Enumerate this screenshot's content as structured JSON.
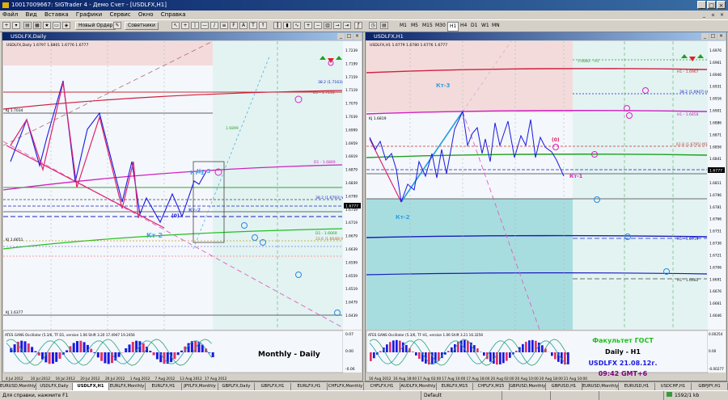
{
  "window": {
    "title": "10017009667: SIGTrader 4 - Демо Счет - [USDLFX,H1]"
  },
  "menu": [
    "Файл",
    "Вид",
    "Вставка",
    "Графики",
    "Сервис",
    "Окно",
    "Справка"
  ],
  "toolbar": {
    "new_order": "Новый Ордер",
    "advisors": "Советники",
    "timeframes": [
      "M1",
      "M5",
      "M15",
      "M30",
      "H1",
      "H4",
      "D1",
      "W1",
      "MN"
    ]
  },
  "left_chart": {
    "window_title": "USDLFX,Daily",
    "info": "USDLFX,Daily  1.6797 1.6801 1.6776 1.6777",
    "price_axis": [
      "1.7239",
      "1.7199",
      "1.7159",
      "1.7119",
      "1.7079",
      "1.7039",
      "1.6999",
      "1.6959",
      "1.6919",
      "1.6879",
      "1.6839",
      "1.6799",
      "1.6759",
      "1.6719",
      "1.6679",
      "1.6639",
      "1.6599",
      "1.6559",
      "1.6519",
      "1.6479",
      "1.6439"
    ],
    "current_price": "1.6777",
    "dates": [
      "4 Jul 2012",
      "10 Jul 2012",
      "16 Jul 2012",
      "20 Jul 2012",
      "26 Jul 2012",
      "1 Aug 2012",
      "7 Aug 2012",
      "13 Aug 2012",
      "17 Aug 2012"
    ],
    "labels": {
      "kt1": "Кт-1",
      "kt2": "Кт-2",
      "kt2b": "Кт-2",
      "kt3": "Кт-3",
      "zero": "(0)",
      "monthly": "Monthly - Daily",
      "r1": "D1 - 1.7116",
      "r2": "D1 - 1.6869",
      "r3": "38.2 (1.7163) M1",
      "r4": "38.2 (1.6793) W1",
      "r5": "D1 - 1.6669",
      "r6": "23.6 (1.6648) M1",
      "kj1": "KJ 1.7034",
      "kj2": "KJ 1.6651",
      "kj3": "KJ 1.6377",
      "pl": "1.6899"
    },
    "oscillator": {
      "label": "ATES GANS Oscillator (5.3/6,  TF  D1,  version 1.06   Shift 3.20  17.4947  19.2456",
      "scale": [
        "0.07",
        "0.00",
        "-0.06"
      ]
    }
  },
  "right_chart": {
    "window_title": "USDLFX,H1",
    "info": "USDLFX,H1  1.6779 1.6780 1.6776 1.6777",
    "price_axis": [
      "1.6976",
      "1.6961",
      "1.6946",
      "1.6931",
      "1.6916",
      "1.6901",
      "1.6886",
      "1.6871",
      "1.6856",
      "1.6841",
      "1.6826",
      "1.6811",
      "1.6796",
      "1.6781",
      "1.6766",
      "1.6751",
      "1.6736",
      "1.6721",
      "1.6706",
      "1.6691",
      "1.6676",
      "1.6661",
      "1.6646"
    ],
    "current_price": "1.6777",
    "dates": [
      "16 Aug 2012",
      "16 Aug 18:00",
      "17 Aug 02:00",
      "17 Aug 10:00",
      "17 Aug 18:00",
      "20 Aug 02:00",
      "20 Aug 10:00",
      "20 Aug 18:00",
      "21 Aug 10:00"
    ],
    "labels": {
      "kt1": "Кт-1",
      "kt2": "Кт-2",
      "kt3": "Кт-3",
      "zero": "(0)",
      "h1a": "H1 - 1.6967",
      "h1b": "38.2 (1.6947) H1",
      "h1c": "H1 - 1.6858",
      "h1d": "61.8 (1.6795) M1",
      "h1e": "H1 - 1.6719",
      "h1f": "H1 - 1.6682",
      "kj": "KJ 1.6819",
      "pl1": "1.6882 - H1"
    },
    "oscillator": {
      "label": "ATES GANS Oscillator (5.3/6,  TF  H1,  version 1.06   Shift 3.21  16.3256",
      "scale": [
        "0.00254",
        "0.00",
        "-0.00277"
      ]
    },
    "overlay": {
      "faculty": "Факультет ГОСТ",
      "tf": "Daily - H1",
      "symbol_date": "USDLFX 21.08.12г.",
      "time": "09:42  GMT+6"
    }
  },
  "tabs": [
    "EURUSD,Monthly",
    "USDLFX,Daily",
    "USDLFX,H1",
    "EURLFX,Monthly",
    "EURLFX,H1",
    "JPYLFX,Monthly",
    "GBPLFX,Daily",
    "GBPLFX,H1",
    "EURLFX,H1",
    "CHFLFX,Monthly",
    "CHFLFX,H1",
    "AUDLFX,Monthly",
    "EURLFX,M15",
    "CHFLFX,M15",
    "GBPUSD,Monthly",
    "GBPUSD,H1",
    "EURUSD,Monthly",
    "EURUSD,H1",
    "USDCHF,H1",
    "GBPJPY,H1"
  ],
  "active_tab": 2,
  "status": {
    "help": "Для справки, нажмите F1",
    "profile": "Default",
    "traffic": "1592/1 kb"
  },
  "colors": {
    "title_bar": "#0a246a",
    "chart_bg": "#f4f7fb",
    "price_line": "#2020c0",
    "zigzag": "#e0206a",
    "teal_zone": "#a8dde0",
    "pink_zone": "#f3dbdb",
    "overlay_green": "#1dc01d",
    "overlay_blue": "#1a1ae0"
  }
}
